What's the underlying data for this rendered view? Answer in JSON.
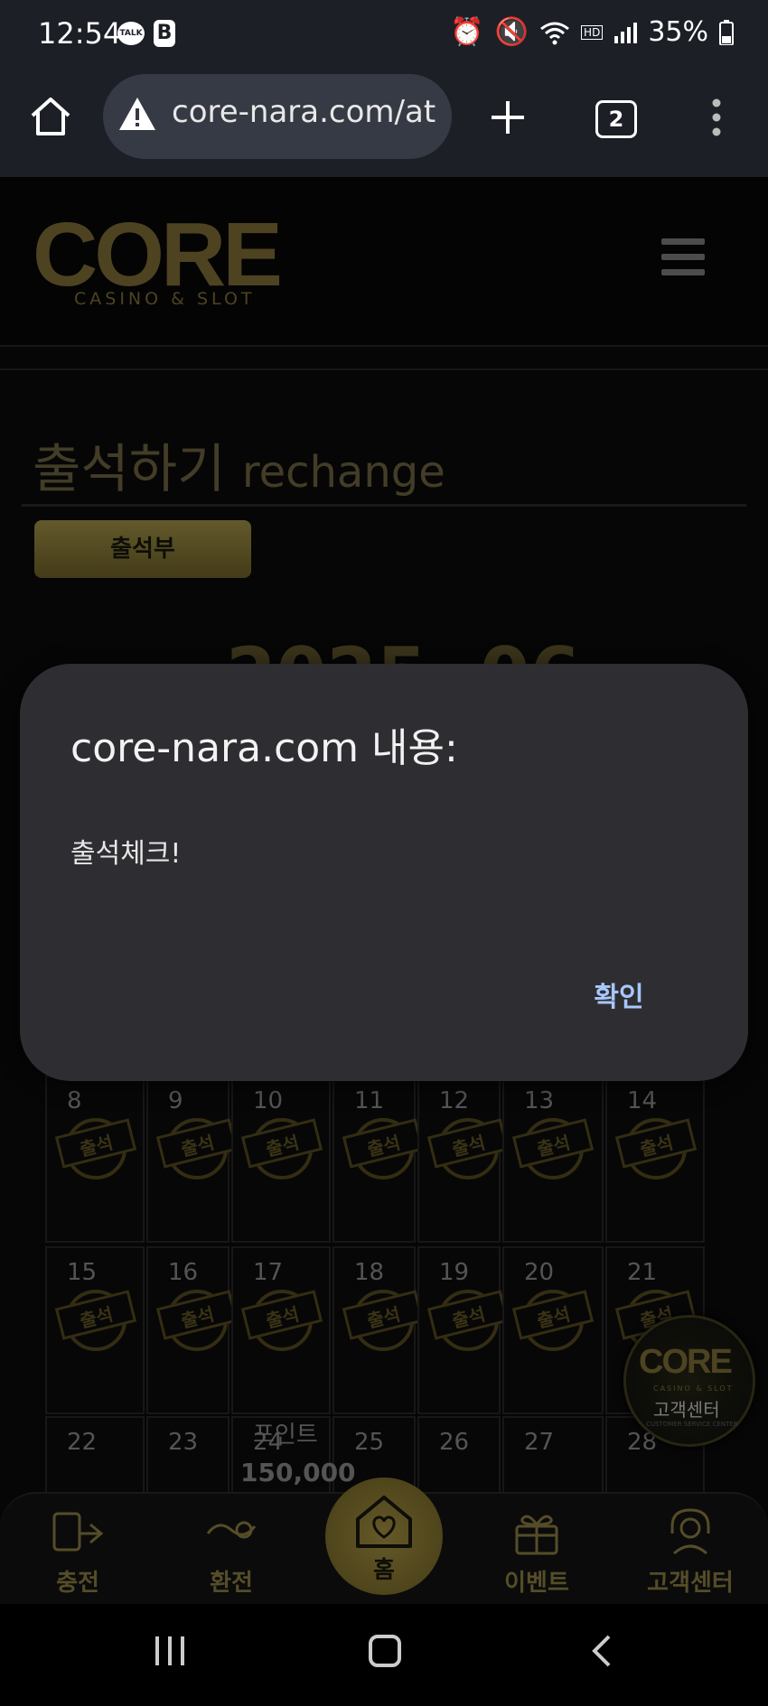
{
  "status_bar": {
    "time": "12:54",
    "talk_badge": "TALK",
    "b_badge": "B",
    "battery": "35%"
  },
  "browser": {
    "url": "core-nara.com/at",
    "tab_count": "2"
  },
  "site": {
    "logo": "CORE",
    "logo_sub": "CASINO & SLOT",
    "page_title_ko": "출석하기",
    "page_title_en": "rechange",
    "attendance_button": "출석부",
    "month_partial": "2025. 06",
    "stamp_text": "출석"
  },
  "calendar": {
    "rows": [
      {
        "days": [
          "8",
          "9",
          "10",
          "11",
          "12",
          "13",
          "14"
        ],
        "stamped": true
      },
      {
        "days": [
          "15",
          "16",
          "17",
          "18",
          "19",
          "20",
          "21"
        ],
        "stamped": true
      },
      {
        "days": [
          "22",
          "23",
          "24",
          "25",
          "26",
          "27",
          "28"
        ],
        "stamped": false
      }
    ],
    "point_label": "포인트",
    "point_value": "150,000"
  },
  "floating_cs": {
    "logo": "CORE",
    "sub": "CASINO & SLOT",
    "label": "고객센터",
    "tiny": "CUSTOMER SERVICE CENTER"
  },
  "bottom_nav": {
    "charge": "충전",
    "exchange": "환전",
    "home": "홈",
    "event": "이벤트",
    "support": "고객센터"
  },
  "dialog": {
    "title": "core-nara.com 내용:",
    "message": "출석체크!",
    "ok": "확인"
  },
  "colors": {
    "gold": "#8c7a3c",
    "dialog_bg": "#2e2e32",
    "link_blue": "#a8c7fa"
  }
}
